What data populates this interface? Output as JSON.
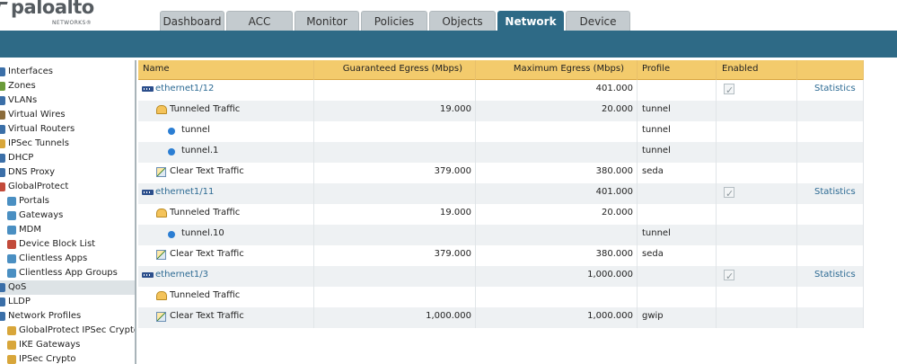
{
  "brand": {
    "name": "paloalto",
    "sub": "NETWORKS®"
  },
  "tabs": [
    {
      "label": "Dashboard",
      "active": false
    },
    {
      "label": "ACC",
      "active": false
    },
    {
      "label": "Monitor",
      "active": false
    },
    {
      "label": "Policies",
      "active": false
    },
    {
      "label": "Objects",
      "active": false
    },
    {
      "label": "Network",
      "active": true
    },
    {
      "label": "Device",
      "active": false
    }
  ],
  "sidebar": {
    "items": [
      {
        "label": "Interfaces",
        "icon": "interfaces-icon",
        "color": "#3b6fa8",
        "indent": 0
      },
      {
        "label": "Zones",
        "icon": "zones-icon",
        "color": "#6a9b3a",
        "indent": 0
      },
      {
        "label": "VLANs",
        "icon": "vlans-icon",
        "color": "#3b6fa8",
        "indent": 0
      },
      {
        "label": "Virtual Wires",
        "icon": "virtual-wires-icon",
        "color": "#8a6b3a",
        "indent": 0
      },
      {
        "label": "Virtual Routers",
        "icon": "virtual-routers-icon",
        "color": "#3b6fa8",
        "indent": 0
      },
      {
        "label": "IPSec Tunnels",
        "icon": "ipsec-tunnels-icon",
        "color": "#d8a63a",
        "indent": 0
      },
      {
        "label": "DHCP",
        "icon": "dhcp-icon",
        "color": "#3b6fa8",
        "indent": 0
      },
      {
        "label": "DNS Proxy",
        "icon": "dns-proxy-icon",
        "color": "#3b6fa8",
        "indent": 0
      },
      {
        "label": "GlobalProtect",
        "icon": "globalprotect-icon",
        "color": "#c24a3a",
        "indent": 0
      },
      {
        "label": "Portals",
        "icon": "portals-icon",
        "color": "#4a8fc2",
        "indent": 1
      },
      {
        "label": "Gateways",
        "icon": "gateways-icon",
        "color": "#4a8fc2",
        "indent": 1
      },
      {
        "label": "MDM",
        "icon": "mdm-icon",
        "color": "#4a8fc2",
        "indent": 1
      },
      {
        "label": "Device Block List",
        "icon": "device-block-list-icon",
        "color": "#c24a3a",
        "indent": 1
      },
      {
        "label": "Clientless Apps",
        "icon": "clientless-apps-icon",
        "color": "#4a8fc2",
        "indent": 1
      },
      {
        "label": "Clientless App Groups",
        "icon": "clientless-app-groups-icon",
        "color": "#4a8fc2",
        "indent": 1
      },
      {
        "label": "QoS",
        "icon": "qos-icon",
        "color": "#3b6fa8",
        "indent": 0,
        "selected": true
      },
      {
        "label": "LLDP",
        "icon": "lldp-icon",
        "color": "#3b6fa8",
        "indent": 0
      },
      {
        "label": "Network Profiles",
        "icon": "network-profiles-icon",
        "color": "#3b6fa8",
        "indent": 0
      },
      {
        "label": "GlobalProtect IPSec Crypto",
        "icon": "gp-ipsec-crypto-icon",
        "color": "#d8a63a",
        "indent": 1
      },
      {
        "label": "IKE Gateways",
        "icon": "ike-gateways-icon",
        "color": "#d8a63a",
        "indent": 1
      },
      {
        "label": "IPSec Crypto",
        "icon": "ipsec-crypto-icon",
        "color": "#d8a63a",
        "indent": 1
      }
    ]
  },
  "table": {
    "columns": [
      "Name",
      "Guaranteed Egress (Mbps)",
      "Maximum Egress (Mbps)",
      "Profile",
      "Enabled",
      ""
    ],
    "rows": [
      {
        "type": "iface",
        "name": "ethernet1/12",
        "guaranteed": "",
        "maximum": "401.000",
        "profile": "",
        "enabled": true,
        "stats": "Statistics"
      },
      {
        "type": "tunnel",
        "name": "Tunneled Traffic",
        "guaranteed": "19.000",
        "maximum": "20.000",
        "profile": "tunnel",
        "enabled": false,
        "stats": ""
      },
      {
        "type": "dot",
        "name": "tunnel",
        "guaranteed": "",
        "maximum": "",
        "profile": "tunnel",
        "enabled": false,
        "stats": ""
      },
      {
        "type": "dot",
        "name": "tunnel.1",
        "guaranteed": "",
        "maximum": "",
        "profile": "tunnel",
        "enabled": false,
        "stats": ""
      },
      {
        "type": "clear",
        "name": "Clear Text Traffic",
        "guaranteed": "379.000",
        "maximum": "380.000",
        "profile": "seda",
        "enabled": false,
        "stats": ""
      },
      {
        "type": "iface",
        "name": "ethernet1/11",
        "guaranteed": "",
        "maximum": "401.000",
        "profile": "",
        "enabled": true,
        "stats": "Statistics"
      },
      {
        "type": "tunnel",
        "name": "Tunneled Traffic",
        "guaranteed": "19.000",
        "maximum": "20.000",
        "profile": "",
        "enabled": false,
        "stats": ""
      },
      {
        "type": "dot",
        "name": "tunnel.10",
        "guaranteed": "",
        "maximum": "",
        "profile": "tunnel",
        "enabled": false,
        "stats": ""
      },
      {
        "type": "clear",
        "name": "Clear Text Traffic",
        "guaranteed": "379.000",
        "maximum": "380.000",
        "profile": "seda",
        "enabled": false,
        "stats": ""
      },
      {
        "type": "iface",
        "name": "ethernet1/3",
        "guaranteed": "",
        "maximum": "1,000.000",
        "profile": "",
        "enabled": true,
        "stats": "Statistics"
      },
      {
        "type": "tunnel",
        "name": "Tunneled Traffic",
        "guaranteed": "",
        "maximum": "",
        "profile": "",
        "enabled": false,
        "stats": ""
      },
      {
        "type": "clear",
        "name": "Clear Text Traffic",
        "guaranteed": "1,000.000",
        "maximum": "1,000.000",
        "profile": "gwip",
        "enabled": false,
        "stats": ""
      }
    ]
  }
}
